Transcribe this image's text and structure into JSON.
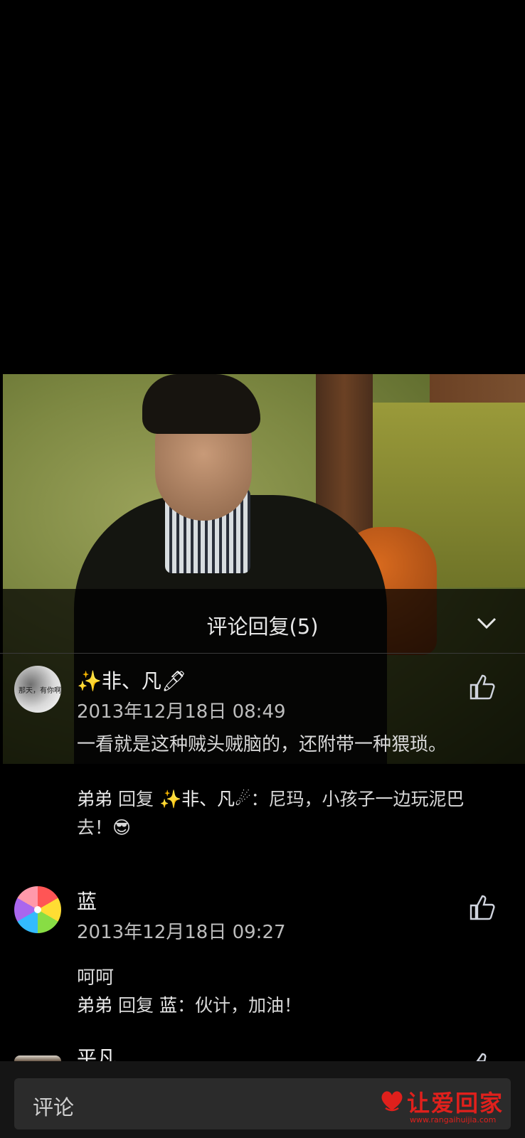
{
  "panel": {
    "title": "评论回复(5)"
  },
  "comments": [
    {
      "user": "✨非、凡🖊",
      "time": "2013年12月18日 08:49",
      "text": "一看就是这种贼头贼脑的，还附带一种猥琐。",
      "reply": {
        "who": "弟弟",
        "verb": "回复",
        "target": "✨非、凡☄",
        "text": "：尼玛，小孩子一边玩泥巴去！😎"
      },
      "avatar_text": "那天，有你啊"
    },
    {
      "user": "蓝",
      "time": "2013年12月18日 09:27",
      "text": "呵呵",
      "reply": {
        "who": "弟弟",
        "verb": "回复",
        "target": "蓝",
        "text": "：伙计，加油！"
      }
    },
    {
      "user": "平凡"
    }
  ],
  "footer": {
    "input_placeholder": "评论",
    "logo_text": "让爱回家",
    "logo_url": "www.rangaihuijia.com"
  },
  "colors": {
    "accent": "#e0201c",
    "background": "#000000"
  }
}
